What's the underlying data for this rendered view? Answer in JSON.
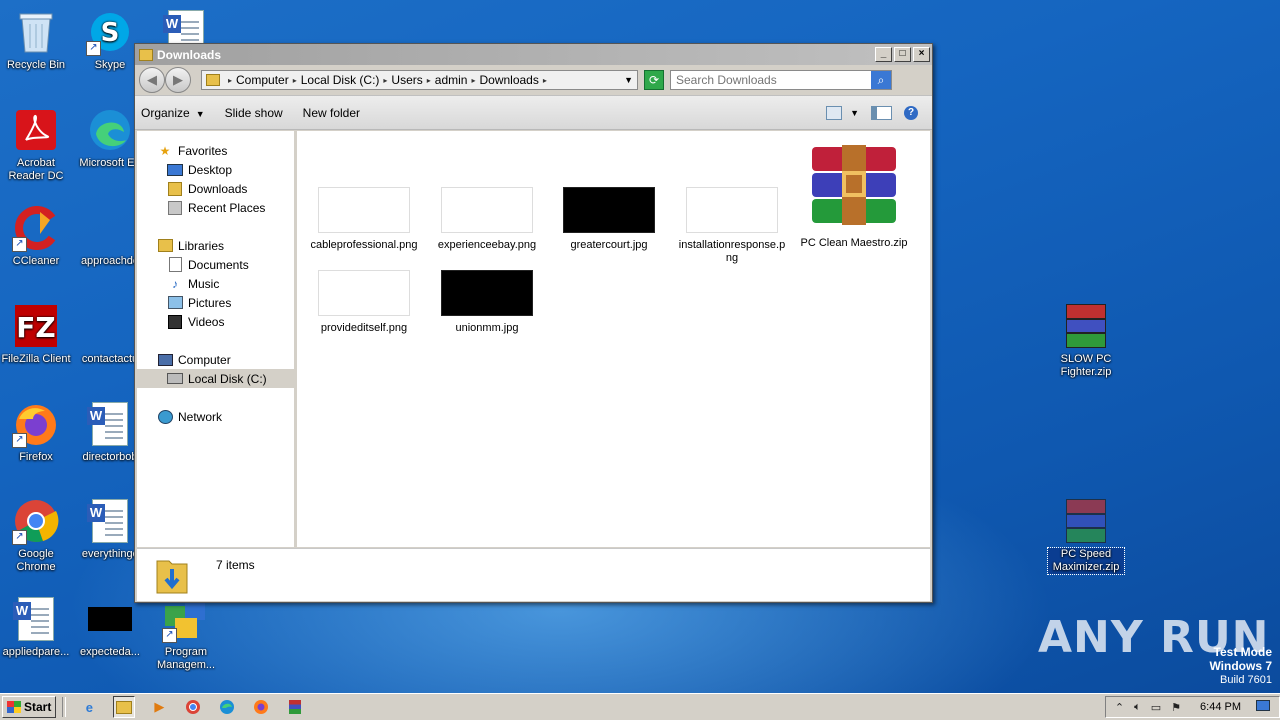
{
  "desktop": {
    "icons": [
      {
        "label": "Recycle Bin"
      },
      {
        "label": "Skype"
      },
      {
        "label": "Acrobat Reader DC"
      },
      {
        "label": "Microsoft Ed"
      },
      {
        "label": "CCleaner"
      },
      {
        "label": "approachde"
      },
      {
        "label": "FileZilla Client"
      },
      {
        "label": "contactactu"
      },
      {
        "label": "Firefox"
      },
      {
        "label": "directorbob"
      },
      {
        "label": "Google Chrome"
      },
      {
        "label": "everythingc"
      },
      {
        "label": "appliedpare..."
      },
      {
        "label": "expecteda..."
      },
      {
        "label": "Program Managem..."
      },
      {
        "label": "SLOW PC Fighter.zip"
      },
      {
        "label": "PC Speed Maximizer.zip"
      }
    ]
  },
  "window": {
    "title": "Downloads",
    "address": {
      "crumbs": [
        "Computer",
        "Local Disk (C:)",
        "Users",
        "admin",
        "Downloads"
      ]
    },
    "search": {
      "placeholder": "Search Downloads"
    },
    "toolbar": {
      "organize": "Organize",
      "slideshow": "Slide show",
      "new_folder": "New folder"
    },
    "nav": {
      "favorites": "Favorites",
      "desktop": "Desktop",
      "downloads": "Downloads",
      "recent": "Recent Places",
      "libraries": "Libraries",
      "documents": "Documents",
      "music": "Music",
      "pictures": "Pictures",
      "videos": "Videos",
      "computer": "Computer",
      "local_disk": "Local Disk (C:)",
      "network": "Network"
    },
    "files": [
      {
        "name": "cableprofessional.png",
        "thumb": "white"
      },
      {
        "name": "experienceebay.png",
        "thumb": "white"
      },
      {
        "name": "greatercourt.jpg",
        "thumb": "black"
      },
      {
        "name": "installationresponse.png",
        "thumb": "white"
      },
      {
        "name": "PC Clean Maestro.zip",
        "thumb": "rar"
      },
      {
        "name": "provideditself.png",
        "thumb": "white"
      },
      {
        "name": "unionmm.jpg",
        "thumb": "black"
      }
    ],
    "details": {
      "count": "7 items"
    }
  },
  "taskbar": {
    "start": "Start",
    "clock": "6:44 PM"
  },
  "watermark": {
    "line1": "Test Mode",
    "line2": "Windows 7",
    "line3": "Build 7601",
    "brand": "ANY RUN"
  },
  "colors": {
    "desktop_bg": "#1565c0",
    "selection": "#0a3d91",
    "window_chrome": "#d4d0c8"
  }
}
